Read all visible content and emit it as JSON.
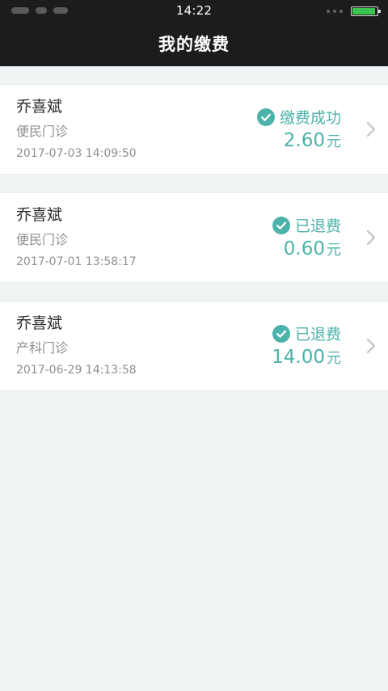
{
  "status_bar": {
    "time": "14:22"
  },
  "header": {
    "title": "我的缴费"
  },
  "records": [
    {
      "name": "乔喜斌",
      "department": "便民门诊",
      "time": "2017-07-03 14:09:50",
      "status": "缴费成功",
      "amount": "2.60",
      "unit": "元"
    },
    {
      "name": "乔喜斌",
      "department": "便民门诊",
      "time": "2017-07-01 13:58:17",
      "status": "已退费",
      "amount": "0.60",
      "unit": "元"
    },
    {
      "name": "乔喜斌",
      "department": "产科门诊",
      "time": "2017-06-29 14:13:58",
      "status": "已退费",
      "amount": "14.00",
      "unit": "元"
    }
  ],
  "colors": {
    "accent": "#4cb3aa",
    "header_bg": "#1c1c1e",
    "page_bg": "#eff3f4"
  }
}
